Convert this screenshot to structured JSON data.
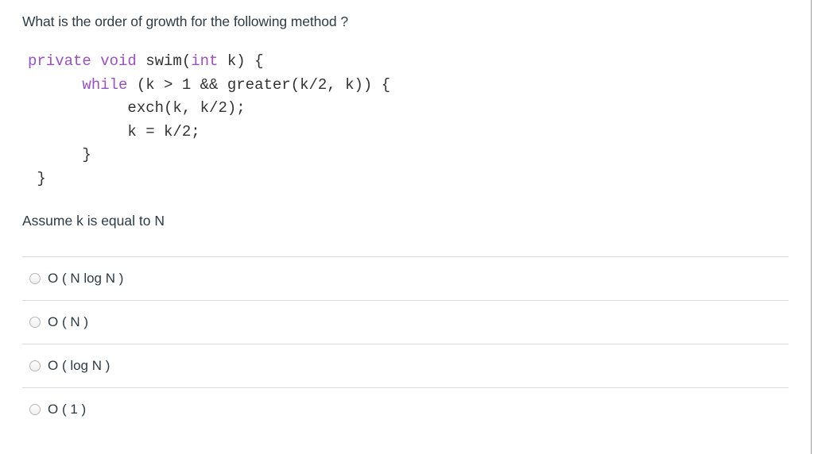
{
  "question": {
    "title": "What is the order of growth for the following method ?",
    "code_lines": [
      {
        "indent": "",
        "segments": [
          {
            "kw": true,
            "text": "private void"
          },
          {
            "kw": false,
            "text": " swim("
          },
          {
            "kw": true,
            "text": "int"
          },
          {
            "kw": false,
            "text": " k) {"
          }
        ]
      },
      {
        "indent": "      ",
        "segments": [
          {
            "kw": true,
            "text": "while"
          },
          {
            "kw": false,
            "text": " (k > 1 && greater(k/2, k)) {"
          }
        ]
      },
      {
        "indent": "           ",
        "segments": [
          {
            "kw": false,
            "text": "exch(k, k/2);"
          }
        ]
      },
      {
        "indent": "           ",
        "segments": [
          {
            "kw": false,
            "text": "k = k/2;"
          }
        ]
      },
      {
        "indent": "      ",
        "segments": [
          {
            "kw": false,
            "text": "}"
          }
        ]
      },
      {
        "indent": " ",
        "segments": [
          {
            "kw": false,
            "text": "}"
          }
        ]
      }
    ],
    "assumption": "Assume k is equal to N"
  },
  "answers": [
    {
      "label": "O ( N log N )",
      "selected": false
    },
    {
      "label": "O ( N )",
      "selected": false
    },
    {
      "label": "O ( log N )",
      "selected": false
    },
    {
      "label": "O ( 1 )",
      "selected": false
    }
  ],
  "colors": {
    "text": "#2d3b45",
    "keyword": "#9b4fc6",
    "divider": "#d9d9d9"
  }
}
